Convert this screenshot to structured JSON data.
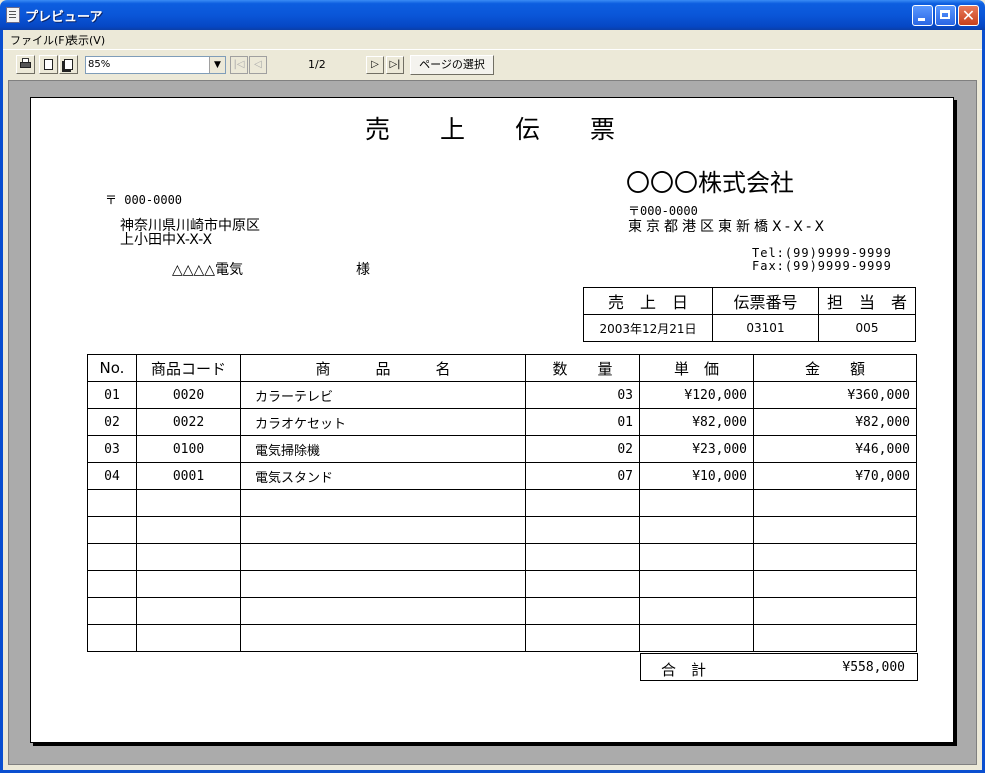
{
  "window": {
    "title": "プレビューア"
  },
  "menu": {
    "file": "ファイル(F)",
    "view": "表示(V)"
  },
  "toolbar": {
    "zoom": "85%",
    "page_indicator": "1/2",
    "page_select": "ページの選択"
  },
  "slip": {
    "title": "売　　上　　伝　　票",
    "customer": {
      "zip": "〒 000-0000",
      "address_line1": "神奈川県川崎市中原区",
      "address_line2": "上小田中X-X-X",
      "name": "△△△△電気",
      "honorific": "様"
    },
    "issuer": {
      "company": "〇〇〇株式会社",
      "zip": "〒000-0000",
      "address": "東京都港区東新橋X-X-X",
      "tel": "Tel:(99)9999-9999",
      "fax": "Fax:(99)9999-9999"
    },
    "info": {
      "headers": [
        "売　上　日",
        "伝票番号",
        "担　当　者"
      ],
      "values": [
        "2003年12月21日",
        "03101",
        "005"
      ]
    },
    "table": {
      "headers": [
        "No.",
        "商品コード",
        "商　　　品　　　名",
        "数　　量",
        "単　価",
        "金　　額"
      ],
      "rows": [
        [
          "01",
          "0020",
          "カラーテレビ",
          "03",
          "¥120,000",
          "¥360,000"
        ],
        [
          "02",
          "0022",
          "カラオケセット",
          "01",
          "¥82,000",
          "¥82,000"
        ],
        [
          "03",
          "0100",
          "電気掃除機",
          "02",
          "¥23,000",
          "¥46,000"
        ],
        [
          "04",
          "0001",
          "電気スタンド",
          "07",
          "¥10,000",
          "¥70,000"
        ],
        [
          "",
          "",
          "",
          "",
          "",
          ""
        ],
        [
          "",
          "",
          "",
          "",
          "",
          ""
        ],
        [
          "",
          "",
          "",
          "",
          "",
          ""
        ],
        [
          "",
          "",
          "",
          "",
          "",
          ""
        ],
        [
          "",
          "",
          "",
          "",
          "",
          ""
        ],
        [
          "",
          "",
          "",
          "",
          "",
          ""
        ]
      ]
    },
    "total": {
      "label": "合　計",
      "value": "¥558,000"
    }
  }
}
